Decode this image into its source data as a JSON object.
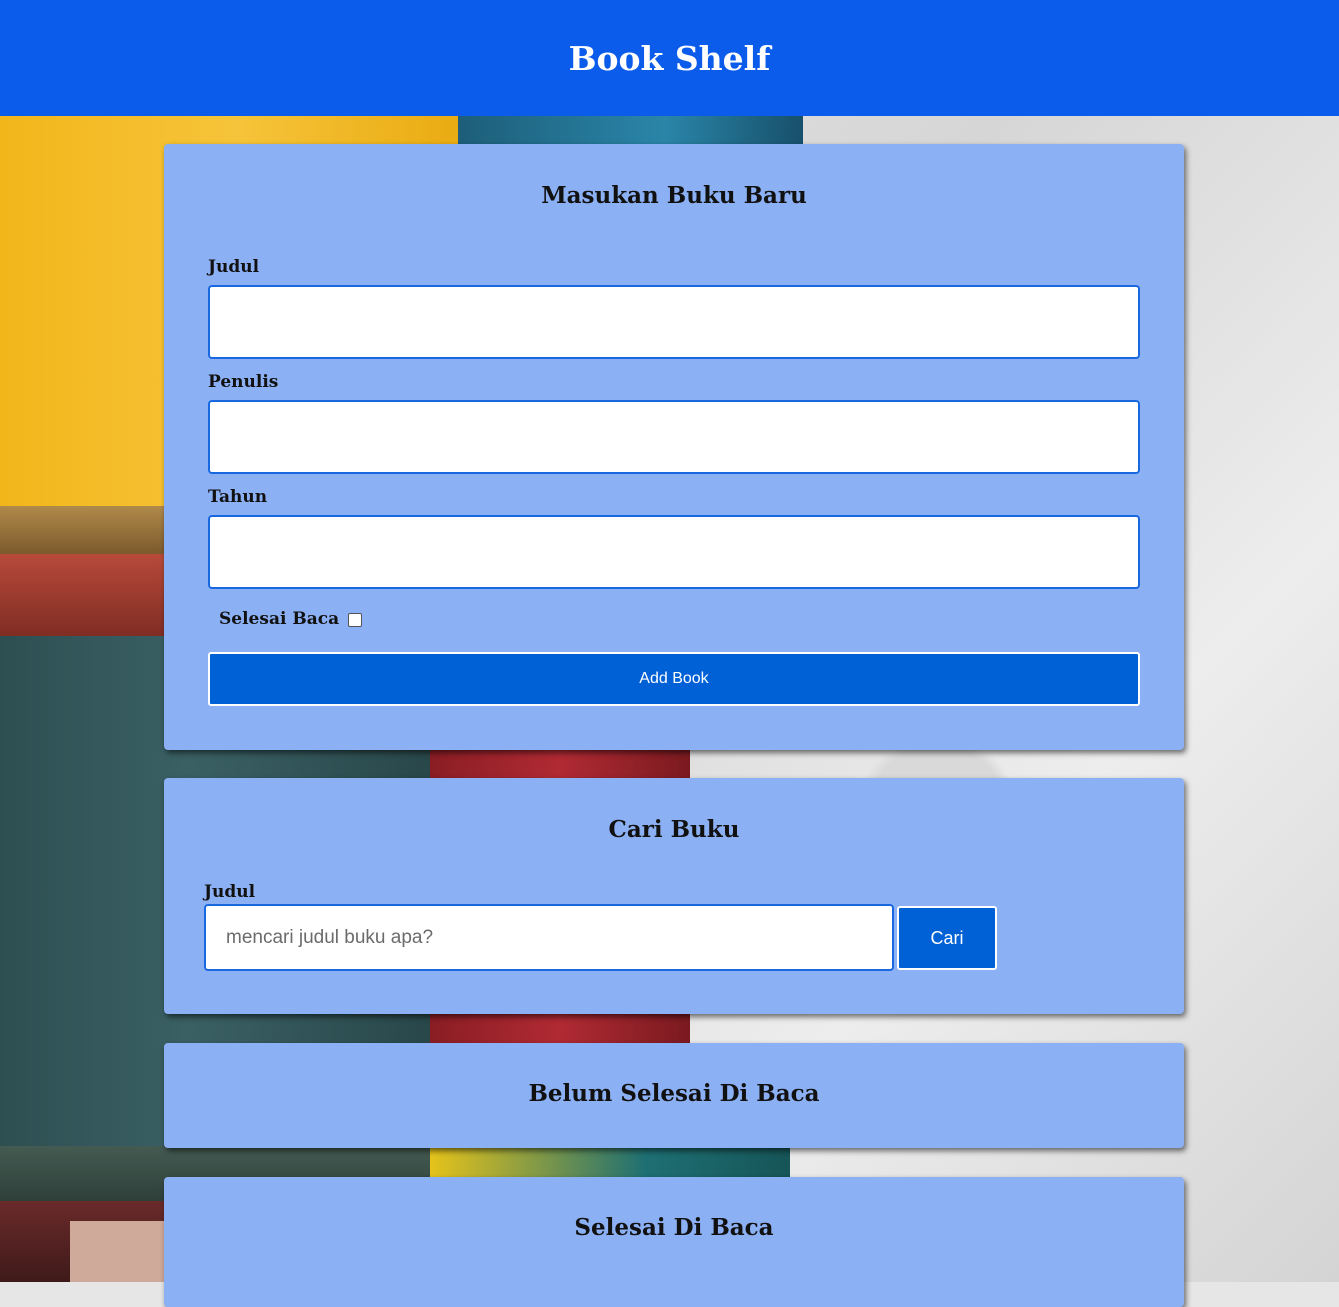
{
  "header": {
    "title": "Book Shelf"
  },
  "add_form": {
    "title": "Masukan Buku Baru",
    "fields": [
      {
        "label": "Judul",
        "value": ""
      },
      {
        "label": "Penulis",
        "value": ""
      },
      {
        "label": "Tahun",
        "value": ""
      }
    ],
    "checkbox_label": "Selesai Baca",
    "checkbox_checked": false,
    "submit_label": "Add Book"
  },
  "search": {
    "title": "Cari Buku",
    "label": "Judul",
    "placeholder": "mencari judul buku apa?",
    "value": "",
    "button_label": "Cari"
  },
  "shelves": {
    "incomplete_title": "Belum Selesai Di Baca",
    "complete_title": "Selesai Di Baca"
  },
  "colors": {
    "header": "#0c5ceb",
    "card": "#8cb0f4",
    "button": "#0060d6",
    "input_border": "#1869e0"
  }
}
